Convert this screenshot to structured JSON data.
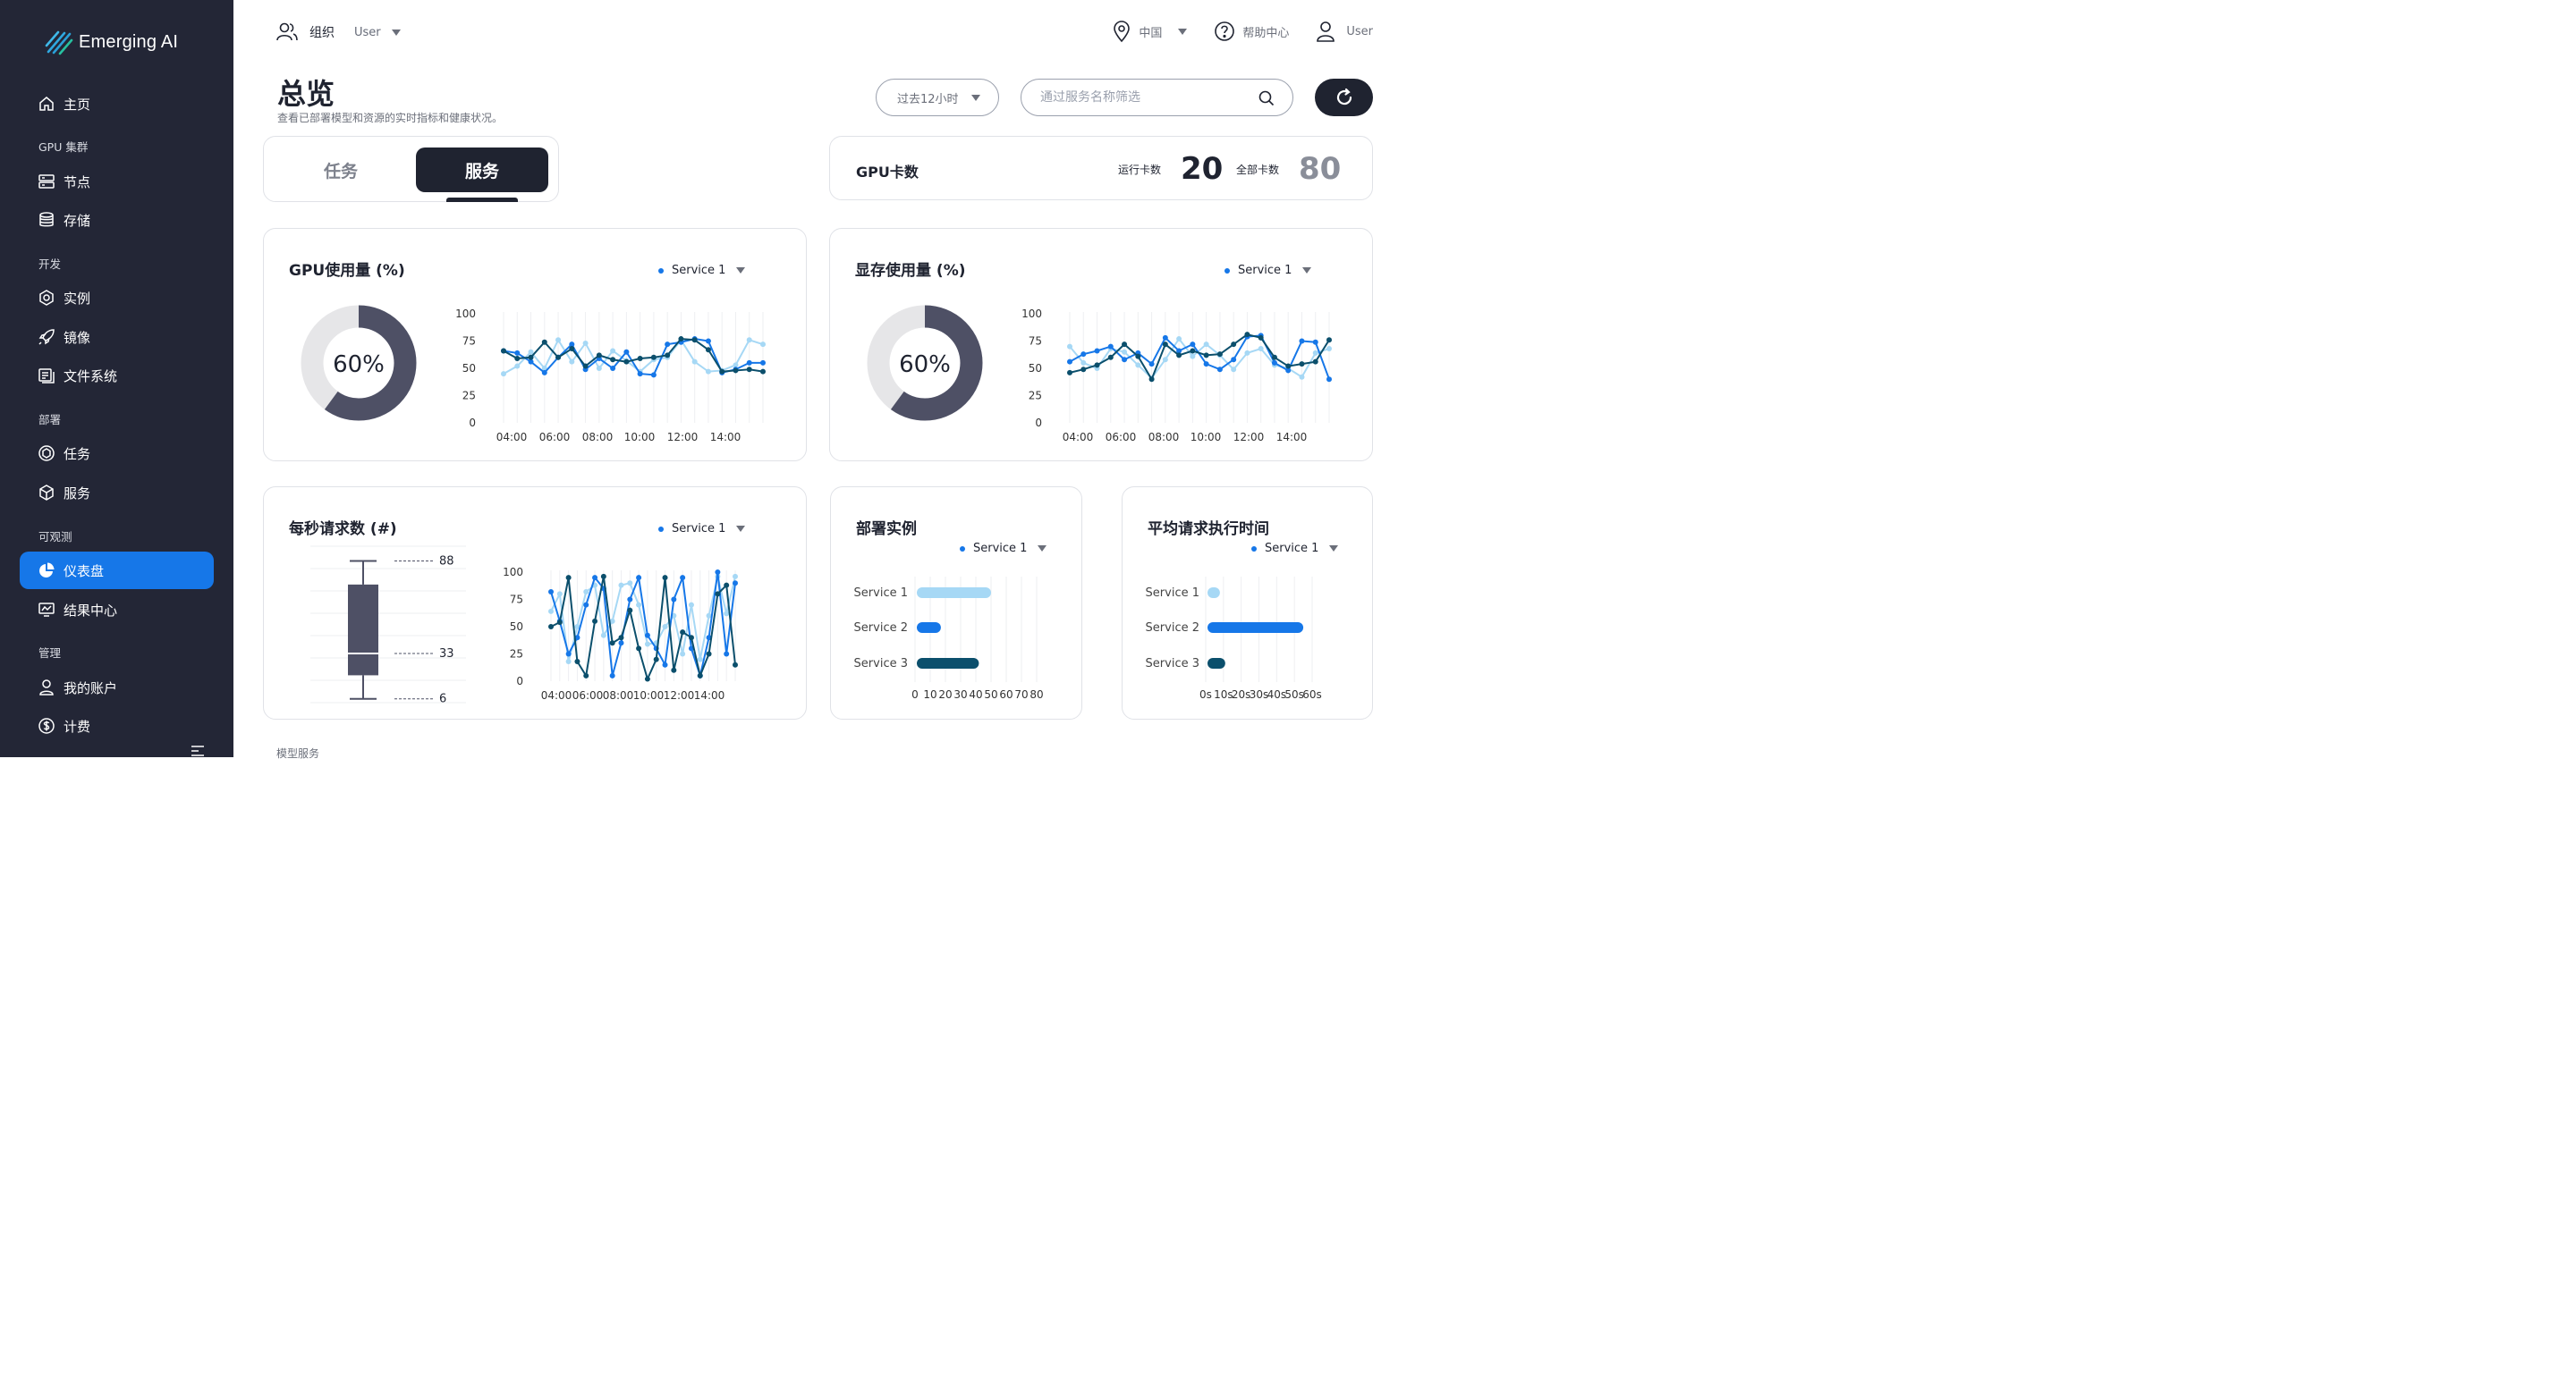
{
  "app": {
    "logo_text": "Emerging AI"
  },
  "colors": {
    "sidebar_bg": "#232636",
    "accent": "#1677e8",
    "dark": "#1f2330",
    "light_blue": "#a6d8f5",
    "navy": "#0b4f6c"
  },
  "sidebar": {
    "items": [
      {
        "label": "主页",
        "icon": "home-icon"
      },
      {
        "section": "GPU 集群"
      },
      {
        "label": "节点",
        "icon": "server-icon"
      },
      {
        "label": "存储",
        "icon": "database-icon"
      },
      {
        "section": "开发"
      },
      {
        "label": "实例",
        "icon": "instance-icon"
      },
      {
        "label": "镜像",
        "icon": "rocket-icon"
      },
      {
        "label": "文件系统",
        "icon": "file-system-icon"
      },
      {
        "section": "部署"
      },
      {
        "label": "任务",
        "icon": "task-icon"
      },
      {
        "label": "服务",
        "icon": "cube-icon"
      },
      {
        "section": "可观测"
      },
      {
        "label": "仪表盘",
        "icon": "pie-chart-icon",
        "active": true
      },
      {
        "label": "结果中心",
        "icon": "monitor-chart-icon"
      },
      {
        "section": "管理"
      },
      {
        "label": "我的账户",
        "icon": "user-icon"
      },
      {
        "label": "计费",
        "icon": "dollar-icon"
      }
    ]
  },
  "topbar": {
    "org_label": "组织",
    "org_user": "User",
    "region": "中国",
    "help": "帮助中心",
    "user": "User"
  },
  "header": {
    "title": "总览",
    "subtitle": "查看已部署模型和资源的实时指标和健康状况。",
    "time_range": "过去12小时",
    "search_placeholder": "通过服务名称筛选"
  },
  "tabs": [
    {
      "label": "任务",
      "active": false
    },
    {
      "label": "服务",
      "active": true
    }
  ],
  "gpu_count": {
    "title": "GPU卡数",
    "running_label": "运行卡数",
    "running_value": "20",
    "total_label": "全部卡数",
    "total_value": "80"
  },
  "cards": {
    "gpu_usage": {
      "title": "GPU使用量 (%)",
      "legend": "Service 1",
      "percent_text": "60%"
    },
    "mem_usage": {
      "title": "显存使用量 (%)",
      "legend": "Service 1",
      "percent_text": "60%"
    },
    "rps": {
      "title": "每秒请求数 (#)",
      "legend": "Service 1"
    },
    "instances": {
      "title": "部署实例",
      "legend": "Service 1"
    },
    "latency": {
      "title": "平均请求执行时间",
      "legend": "Service 1"
    }
  },
  "footer_section": "模型服务",
  "chart_data": [
    {
      "type": "pie",
      "title": "GPU使用量 (%)",
      "values": [
        60,
        40
      ],
      "labels": [
        "used",
        "free"
      ],
      "center_label": "60%"
    },
    {
      "type": "line",
      "title": "GPU使用量 (%)",
      "x_ticks": [
        "04:00",
        "06:00",
        "08:00",
        "10:00",
        "12:00",
        "14:00"
      ],
      "y_ticks": [
        0,
        25,
        50,
        75,
        100
      ],
      "ylim": [
        0,
        100
      ],
      "grid": true,
      "series": [
        {
          "color": "#a6d8f5",
          "values": [
            45,
            52,
            65,
            50,
            76,
            56,
            73,
            50,
            66,
            57,
            47,
            58,
            60,
            76,
            56,
            47,
            48,
            53,
            76,
            72
          ]
        },
        {
          "color": "#1677e8",
          "values": [
            66,
            64,
            56,
            46,
            60,
            72,
            49,
            59,
            50,
            65,
            45,
            44,
            72,
            74,
            77,
            75,
            46,
            49,
            55,
            55
          ]
        },
        {
          "color": "#0b4f6c",
          "values": [
            66,
            59,
            60,
            74,
            60,
            68,
            52,
            62,
            58,
            56,
            59,
            60,
            62,
            77,
            76,
            67,
            47,
            48,
            49,
            47
          ]
        }
      ]
    },
    {
      "type": "pie",
      "title": "显存使用量 (%)",
      "values": [
        60,
        40
      ],
      "labels": [
        "used",
        "free"
      ],
      "center_label": "60%"
    },
    {
      "type": "line",
      "title": "显存使用量 (%)",
      "x_ticks": [
        "04:00",
        "06:00",
        "08:00",
        "10:00",
        "12:00",
        "14:00"
      ],
      "y_ticks": [
        0,
        25,
        50,
        75,
        100
      ],
      "ylim": [
        0,
        100
      ],
      "grid": true,
      "series": [
        {
          "color": "#a6d8f5",
          "values": [
            70,
            55,
            50,
            68,
            65,
            53,
            41,
            58,
            77,
            61,
            72,
            62,
            49,
            64,
            68,
            53,
            50,
            42,
            64,
            68
          ]
        },
        {
          "color": "#1677e8",
          "values": [
            56,
            63,
            66,
            70,
            58,
            64,
            54,
            78,
            66,
            72,
            54,
            49,
            58,
            79,
            80,
            55,
            48,
            75,
            74,
            40
          ]
        },
        {
          "color": "#0b4f6c",
          "values": [
            46,
            49,
            53,
            60,
            72,
            61,
            40,
            72,
            62,
            66,
            62,
            63,
            72,
            81,
            78,
            60,
            52,
            54,
            56,
            76
          ]
        }
      ]
    },
    {
      "type": "box",
      "title": "每秒请求数 (#)",
      "max": 88,
      "q3": 74,
      "median": 33,
      "q1": 20,
      "min": 6,
      "labels": [
        "88",
        "33",
        "6"
      ]
    },
    {
      "type": "line",
      "title": "每秒请求数 (#)",
      "x_ticks": [
        "04:00",
        "06:00",
        "08:00",
        "10:00",
        "12:00",
        "14:00"
      ],
      "y_ticks": [
        0,
        25,
        50,
        75,
        100
      ],
      "ylim": [
        0,
        100
      ],
      "grid": true,
      "series": [
        {
          "color": "#a6d8f5",
          "values": [
            64,
            80,
            18,
            50,
            82,
            88,
            42,
            55,
            88,
            90,
            70,
            34,
            35,
            50,
            60,
            25,
            70,
            20,
            60,
            96,
            62,
            96
          ]
        },
        {
          "color": "#1677e8",
          "values": [
            82,
            55,
            25,
            40,
            70,
            95,
            85,
            5,
            35,
            75,
            95,
            42,
            30,
            15,
            75,
            95,
            30,
            5,
            40,
            100,
            25,
            90
          ]
        },
        {
          "color": "#0b4f6c",
          "values": [
            50,
            54,
            95,
            18,
            5,
            55,
            96,
            35,
            40,
            65,
            30,
            2,
            20,
            95,
            10,
            45,
            40,
            5,
            25,
            80,
            88,
            15
          ]
        }
      ]
    },
    {
      "type": "bar",
      "orientation": "horizontal",
      "title": "部署实例",
      "categories": [
        "Service 1",
        "Service 2",
        "Service 3"
      ],
      "values": [
        50,
        17,
        42
      ],
      "colors": [
        "#a6d8f5",
        "#1677e8",
        "#0b4f6c"
      ],
      "x_ticks": [
        "0",
        "10",
        "20",
        "30",
        "40",
        "50",
        "60",
        "70",
        "80"
      ],
      "xlim": [
        0,
        80
      ]
    },
    {
      "type": "bar",
      "orientation": "horizontal",
      "title": "平均请求执行时间",
      "categories": [
        "Service 1",
        "Service 2",
        "Service 3"
      ],
      "values": [
        8,
        55,
        11
      ],
      "colors": [
        "#a6d8f5",
        "#1677e8",
        "#0b4f6c"
      ],
      "x_ticks": [
        "0s",
        "10s",
        "20s",
        "30s",
        "40s",
        "50s",
        "60s"
      ],
      "xlim": [
        0,
        60
      ]
    }
  ]
}
